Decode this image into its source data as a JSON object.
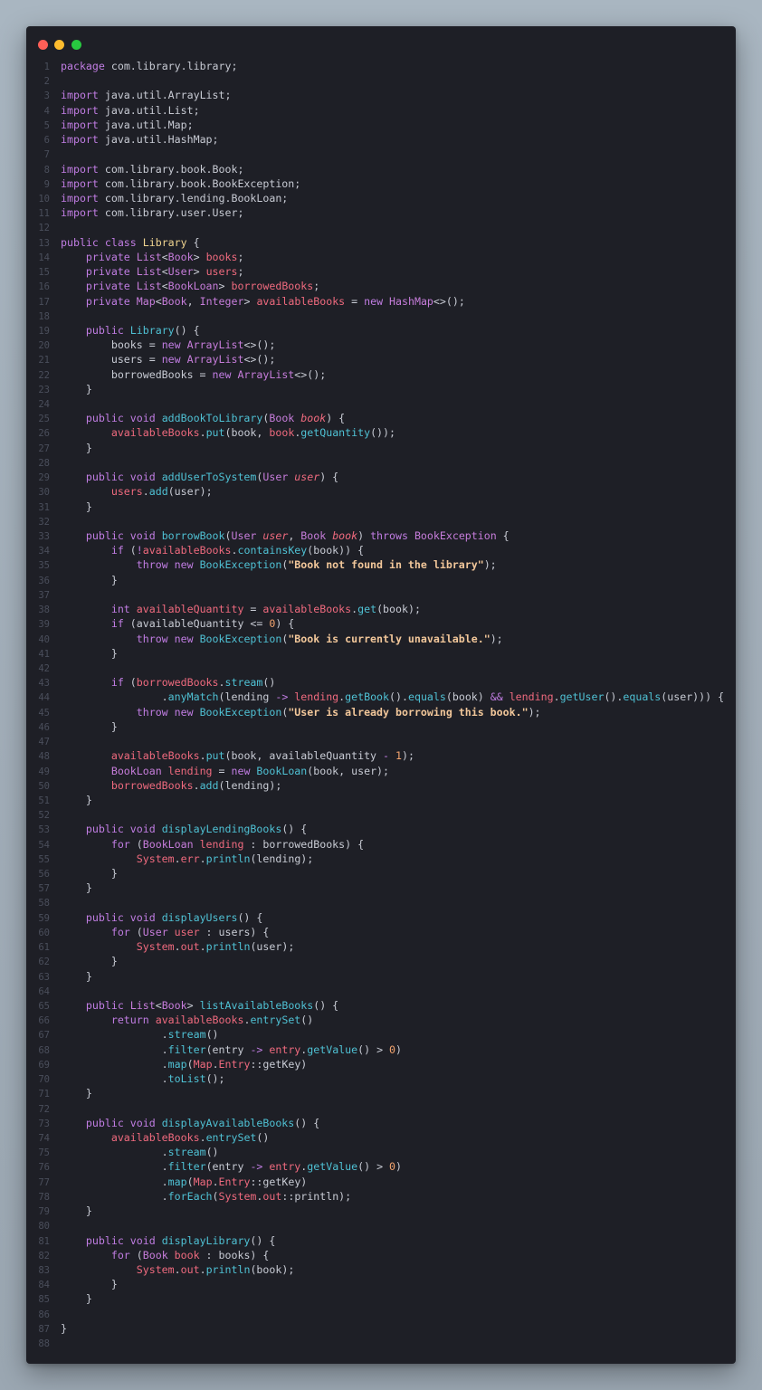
{
  "window": {
    "controls": [
      "close",
      "minimize",
      "maximize"
    ]
  },
  "colors": {
    "keyword": "#c17de3",
    "class_name": "#f0d490",
    "field": "#ef6a7e",
    "method": "#4fc1d4",
    "string": "#f2c79a",
    "number": "#f5a56f",
    "plain": "#c8cbd4",
    "line_number": "#4a4e5b",
    "editor_background": "#1e1f26"
  },
  "code_lines": [
    [
      [
        "kw",
        "package"
      ],
      [
        "p",
        " com.library.library;"
      ]
    ],
    [],
    [
      [
        "kw",
        "import"
      ],
      [
        "p",
        " java.util.ArrayList;"
      ]
    ],
    [
      [
        "kw",
        "import"
      ],
      [
        "p",
        " java.util.List;"
      ]
    ],
    [
      [
        "kw",
        "import"
      ],
      [
        "p",
        " java.util.Map;"
      ]
    ],
    [
      [
        "kw",
        "import"
      ],
      [
        "p",
        " java.util.HashMap;"
      ]
    ],
    [],
    [
      [
        "kw",
        "import"
      ],
      [
        "p",
        " com.library.book.Book;"
      ]
    ],
    [
      [
        "kw",
        "import"
      ],
      [
        "p",
        " com.library.book.BookException;"
      ]
    ],
    [
      [
        "kw",
        "import"
      ],
      [
        "p",
        " com.library.lending.BookLoan;"
      ]
    ],
    [
      [
        "kw",
        "import"
      ],
      [
        "p",
        " com.library.user.User;"
      ]
    ],
    [],
    [
      [
        "kw",
        "public class "
      ],
      [
        "cls",
        "Library"
      ],
      [
        "p",
        " {"
      ]
    ],
    [
      [
        "p",
        "    "
      ],
      [
        "kw",
        "private "
      ],
      [
        "type",
        "List"
      ],
      [
        "p",
        "<"
      ],
      [
        "type",
        "Book"
      ],
      [
        "p",
        "> "
      ],
      [
        "field",
        "books"
      ],
      [
        "p",
        ";"
      ]
    ],
    [
      [
        "p",
        "    "
      ],
      [
        "kw",
        "private "
      ],
      [
        "type",
        "List"
      ],
      [
        "p",
        "<"
      ],
      [
        "type",
        "User"
      ],
      [
        "p",
        "> "
      ],
      [
        "field",
        "users"
      ],
      [
        "p",
        ";"
      ]
    ],
    [
      [
        "p",
        "    "
      ],
      [
        "kw",
        "private "
      ],
      [
        "type",
        "List"
      ],
      [
        "p",
        "<"
      ],
      [
        "type",
        "BookLoan"
      ],
      [
        "p",
        "> "
      ],
      [
        "field",
        "borrowedBooks"
      ],
      [
        "p",
        ";"
      ]
    ],
    [
      [
        "p",
        "    "
      ],
      [
        "kw",
        "private "
      ],
      [
        "type",
        "Map"
      ],
      [
        "p",
        "<"
      ],
      [
        "type",
        "Book"
      ],
      [
        "p",
        ", "
      ],
      [
        "type",
        "Integer"
      ],
      [
        "p",
        "> "
      ],
      [
        "field",
        "availableBooks"
      ],
      [
        "p",
        " = "
      ],
      [
        "kw",
        "new "
      ],
      [
        "type",
        "HashMap"
      ],
      [
        "p",
        "<>();"
      ]
    ],
    [],
    [
      [
        "p",
        "    "
      ],
      [
        "kw",
        "public "
      ],
      [
        "method",
        "Library"
      ],
      [
        "p",
        "() {"
      ]
    ],
    [
      [
        "p",
        "        books = "
      ],
      [
        "kw",
        "new "
      ],
      [
        "type",
        "ArrayList"
      ],
      [
        "p",
        "<>();"
      ]
    ],
    [
      [
        "p",
        "        users = "
      ],
      [
        "kw",
        "new "
      ],
      [
        "type",
        "ArrayList"
      ],
      [
        "p",
        "<>();"
      ]
    ],
    [
      [
        "p",
        "        borrowedBooks = "
      ],
      [
        "kw",
        "new "
      ],
      [
        "type",
        "ArrayList"
      ],
      [
        "p",
        "<>();"
      ]
    ],
    [
      [
        "p",
        "    }"
      ]
    ],
    [],
    [
      [
        "p",
        "    "
      ],
      [
        "kw",
        "public void "
      ],
      [
        "method",
        "addBookToLibrary"
      ],
      [
        "p",
        "("
      ],
      [
        "type",
        "Book "
      ],
      [
        "param",
        "book"
      ],
      [
        "p",
        ") {"
      ]
    ],
    [
      [
        "p",
        "        "
      ],
      [
        "field",
        "availableBooks"
      ],
      [
        "p",
        "."
      ],
      [
        "method",
        "put"
      ],
      [
        "p",
        "(book, "
      ],
      [
        "field",
        "book"
      ],
      [
        "p",
        "."
      ],
      [
        "method",
        "getQuantity"
      ],
      [
        "p",
        "());"
      ]
    ],
    [
      [
        "p",
        "    }"
      ]
    ],
    [],
    [
      [
        "p",
        "    "
      ],
      [
        "kw",
        "public void "
      ],
      [
        "method",
        "addUserToSystem"
      ],
      [
        "p",
        "("
      ],
      [
        "type",
        "User "
      ],
      [
        "param",
        "user"
      ],
      [
        "p",
        ") {"
      ]
    ],
    [
      [
        "p",
        "        "
      ],
      [
        "field",
        "users"
      ],
      [
        "p",
        "."
      ],
      [
        "method",
        "add"
      ],
      [
        "p",
        "(user);"
      ]
    ],
    [
      [
        "p",
        "    }"
      ]
    ],
    [],
    [
      [
        "p",
        "    "
      ],
      [
        "kw",
        "public void "
      ],
      [
        "method",
        "borrowBook"
      ],
      [
        "p",
        "("
      ],
      [
        "type",
        "User "
      ],
      [
        "param",
        "user"
      ],
      [
        "p",
        ", "
      ],
      [
        "type",
        "Book "
      ],
      [
        "param",
        "book"
      ],
      [
        "p",
        ") "
      ],
      [
        "kw",
        "throws "
      ],
      [
        "type",
        "BookException"
      ],
      [
        "p",
        " {"
      ]
    ],
    [
      [
        "p",
        "        "
      ],
      [
        "kw",
        "if "
      ],
      [
        "p",
        "("
      ],
      [
        "op",
        "!"
      ],
      [
        "field",
        "availableBooks"
      ],
      [
        "p",
        "."
      ],
      [
        "method",
        "containsKey"
      ],
      [
        "p",
        "(book)) {"
      ]
    ],
    [
      [
        "p",
        "            "
      ],
      [
        "kw",
        "throw new "
      ],
      [
        "method",
        "BookException"
      ],
      [
        "p",
        "("
      ],
      [
        "str",
        "\"Book not found in the library\""
      ],
      [
        "p",
        ");"
      ]
    ],
    [
      [
        "p",
        "        }"
      ]
    ],
    [],
    [
      [
        "p",
        "        "
      ],
      [
        "kw",
        "int "
      ],
      [
        "field",
        "availableQuantity"
      ],
      [
        "p",
        " = "
      ],
      [
        "field",
        "availableBooks"
      ],
      [
        "p",
        "."
      ],
      [
        "method",
        "get"
      ],
      [
        "p",
        "(book);"
      ]
    ],
    [
      [
        "p",
        "        "
      ],
      [
        "kw",
        "if "
      ],
      [
        "p",
        "(availableQuantity <= "
      ],
      [
        "num",
        "0"
      ],
      [
        "p",
        ") {"
      ]
    ],
    [
      [
        "p",
        "            "
      ],
      [
        "kw",
        "throw new "
      ],
      [
        "method",
        "BookException"
      ],
      [
        "p",
        "("
      ],
      [
        "str",
        "\"Book is currently unavailable.\""
      ],
      [
        "p",
        ");"
      ]
    ],
    [
      [
        "p",
        "        }"
      ]
    ],
    [],
    [
      [
        "p",
        "        "
      ],
      [
        "kw",
        "if "
      ],
      [
        "p",
        "("
      ],
      [
        "field",
        "borrowedBooks"
      ],
      [
        "p",
        "."
      ],
      [
        "method",
        "stream"
      ],
      [
        "p",
        "()"
      ]
    ],
    [
      [
        "p",
        "                ."
      ],
      [
        "method",
        "anyMatch"
      ],
      [
        "p",
        "(lending "
      ],
      [
        "op",
        "->"
      ],
      [
        "p",
        " "
      ],
      [
        "field",
        "lending"
      ],
      [
        "p",
        "."
      ],
      [
        "method",
        "getBook"
      ],
      [
        "p",
        "()."
      ],
      [
        "method",
        "equals"
      ],
      [
        "p",
        "(book) "
      ],
      [
        "op",
        "&&"
      ],
      [
        "p",
        " "
      ],
      [
        "field",
        "lending"
      ],
      [
        "p",
        "."
      ],
      [
        "method",
        "getUser"
      ],
      [
        "p",
        "()."
      ],
      [
        "method",
        "equals"
      ],
      [
        "p",
        "(user))) {"
      ]
    ],
    [
      [
        "p",
        "            "
      ],
      [
        "kw",
        "throw new "
      ],
      [
        "method",
        "BookException"
      ],
      [
        "p",
        "("
      ],
      [
        "str",
        "\"User is already borrowing this book.\""
      ],
      [
        "p",
        ");"
      ]
    ],
    [
      [
        "p",
        "        }"
      ]
    ],
    [],
    [
      [
        "p",
        "        "
      ],
      [
        "field",
        "availableBooks"
      ],
      [
        "p",
        "."
      ],
      [
        "method",
        "put"
      ],
      [
        "p",
        "(book, availableQuantity "
      ],
      [
        "op",
        "-"
      ],
      [
        "p",
        " "
      ],
      [
        "num",
        "1"
      ],
      [
        "p",
        ");"
      ]
    ],
    [
      [
        "p",
        "        "
      ],
      [
        "type",
        "BookLoan "
      ],
      [
        "field",
        "lending"
      ],
      [
        "p",
        " = "
      ],
      [
        "kw",
        "new "
      ],
      [
        "method",
        "BookLoan"
      ],
      [
        "p",
        "(book, user);"
      ]
    ],
    [
      [
        "p",
        "        "
      ],
      [
        "field",
        "borrowedBooks"
      ],
      [
        "p",
        "."
      ],
      [
        "method",
        "add"
      ],
      [
        "p",
        "(lending);"
      ]
    ],
    [
      [
        "p",
        "    }"
      ]
    ],
    [],
    [
      [
        "p",
        "    "
      ],
      [
        "kw",
        "public void "
      ],
      [
        "method",
        "displayLendingBooks"
      ],
      [
        "p",
        "() {"
      ]
    ],
    [
      [
        "p",
        "        "
      ],
      [
        "kw",
        "for "
      ],
      [
        "p",
        "("
      ],
      [
        "type",
        "BookLoan "
      ],
      [
        "field",
        "lending"
      ],
      [
        "p",
        " : borrowedBooks) {"
      ]
    ],
    [
      [
        "p",
        "            "
      ],
      [
        "field",
        "System"
      ],
      [
        "p",
        "."
      ],
      [
        "field",
        "err"
      ],
      [
        "p",
        "."
      ],
      [
        "method",
        "println"
      ],
      [
        "p",
        "(lending);"
      ]
    ],
    [
      [
        "p",
        "        }"
      ]
    ],
    [
      [
        "p",
        "    }"
      ]
    ],
    [],
    [
      [
        "p",
        "    "
      ],
      [
        "kw",
        "public void "
      ],
      [
        "method",
        "displayUsers"
      ],
      [
        "p",
        "() {"
      ]
    ],
    [
      [
        "p",
        "        "
      ],
      [
        "kw",
        "for "
      ],
      [
        "p",
        "("
      ],
      [
        "type",
        "User "
      ],
      [
        "field",
        "user"
      ],
      [
        "p",
        " : users) {"
      ]
    ],
    [
      [
        "p",
        "            "
      ],
      [
        "field",
        "System"
      ],
      [
        "p",
        "."
      ],
      [
        "field",
        "out"
      ],
      [
        "p",
        "."
      ],
      [
        "method",
        "println"
      ],
      [
        "p",
        "(user);"
      ]
    ],
    [
      [
        "p",
        "        }"
      ]
    ],
    [
      [
        "p",
        "    }"
      ]
    ],
    [],
    [
      [
        "p",
        "    "
      ],
      [
        "kw",
        "public "
      ],
      [
        "type",
        "List"
      ],
      [
        "p",
        "<"
      ],
      [
        "type",
        "Book"
      ],
      [
        "p",
        "> "
      ],
      [
        "method",
        "listAvailableBooks"
      ],
      [
        "p",
        "() {"
      ]
    ],
    [
      [
        "p",
        "        "
      ],
      [
        "kw",
        "return "
      ],
      [
        "field",
        "availableBooks"
      ],
      [
        "p",
        "."
      ],
      [
        "method",
        "entrySet"
      ],
      [
        "p",
        "()"
      ]
    ],
    [
      [
        "p",
        "                ."
      ],
      [
        "method",
        "stream"
      ],
      [
        "p",
        "()"
      ]
    ],
    [
      [
        "p",
        "                ."
      ],
      [
        "method",
        "filter"
      ],
      [
        "p",
        "(entry "
      ],
      [
        "op",
        "->"
      ],
      [
        "p",
        " "
      ],
      [
        "field",
        "entry"
      ],
      [
        "p",
        "."
      ],
      [
        "method",
        "getValue"
      ],
      [
        "p",
        "() > "
      ],
      [
        "num",
        "0"
      ],
      [
        "p",
        ")"
      ]
    ],
    [
      [
        "p",
        "                ."
      ],
      [
        "method",
        "map"
      ],
      [
        "p",
        "("
      ],
      [
        "field",
        "Map"
      ],
      [
        "p",
        "."
      ],
      [
        "field",
        "Entry"
      ],
      [
        "p",
        "::getKey)"
      ]
    ],
    [
      [
        "p",
        "                ."
      ],
      [
        "method",
        "toList"
      ],
      [
        "p",
        "();"
      ]
    ],
    [
      [
        "p",
        "    }"
      ]
    ],
    [],
    [
      [
        "p",
        "    "
      ],
      [
        "kw",
        "public void "
      ],
      [
        "method",
        "displayAvailableBooks"
      ],
      [
        "p",
        "() {"
      ]
    ],
    [
      [
        "p",
        "        "
      ],
      [
        "field",
        "availableBooks"
      ],
      [
        "p",
        "."
      ],
      [
        "method",
        "entrySet"
      ],
      [
        "p",
        "()"
      ]
    ],
    [
      [
        "p",
        "                ."
      ],
      [
        "method",
        "stream"
      ],
      [
        "p",
        "()"
      ]
    ],
    [
      [
        "p",
        "                ."
      ],
      [
        "method",
        "filter"
      ],
      [
        "p",
        "(entry "
      ],
      [
        "op",
        "->"
      ],
      [
        "p",
        " "
      ],
      [
        "field",
        "entry"
      ],
      [
        "p",
        "."
      ],
      [
        "method",
        "getValue"
      ],
      [
        "p",
        "() > "
      ],
      [
        "num",
        "0"
      ],
      [
        "p",
        ")"
      ]
    ],
    [
      [
        "p",
        "                ."
      ],
      [
        "method",
        "map"
      ],
      [
        "p",
        "("
      ],
      [
        "field",
        "Map"
      ],
      [
        "p",
        "."
      ],
      [
        "field",
        "Entry"
      ],
      [
        "p",
        "::getKey)"
      ]
    ],
    [
      [
        "p",
        "                ."
      ],
      [
        "method",
        "forEach"
      ],
      [
        "p",
        "("
      ],
      [
        "field",
        "System"
      ],
      [
        "p",
        "."
      ],
      [
        "field",
        "out"
      ],
      [
        "p",
        "::println);"
      ]
    ],
    [
      [
        "p",
        "    }"
      ]
    ],
    [],
    [
      [
        "p",
        "    "
      ],
      [
        "kw",
        "public void "
      ],
      [
        "method",
        "displayLibrary"
      ],
      [
        "p",
        "() {"
      ]
    ],
    [
      [
        "p",
        "        "
      ],
      [
        "kw",
        "for "
      ],
      [
        "p",
        "("
      ],
      [
        "type",
        "Book "
      ],
      [
        "field",
        "book"
      ],
      [
        "p",
        " : books) {"
      ]
    ],
    [
      [
        "p",
        "            "
      ],
      [
        "field",
        "System"
      ],
      [
        "p",
        "."
      ],
      [
        "field",
        "out"
      ],
      [
        "p",
        "."
      ],
      [
        "method",
        "println"
      ],
      [
        "p",
        "(book);"
      ]
    ],
    [
      [
        "p",
        "        }"
      ]
    ],
    [
      [
        "p",
        "    }"
      ]
    ],
    [],
    [
      [
        "p",
        "}"
      ]
    ],
    []
  ]
}
